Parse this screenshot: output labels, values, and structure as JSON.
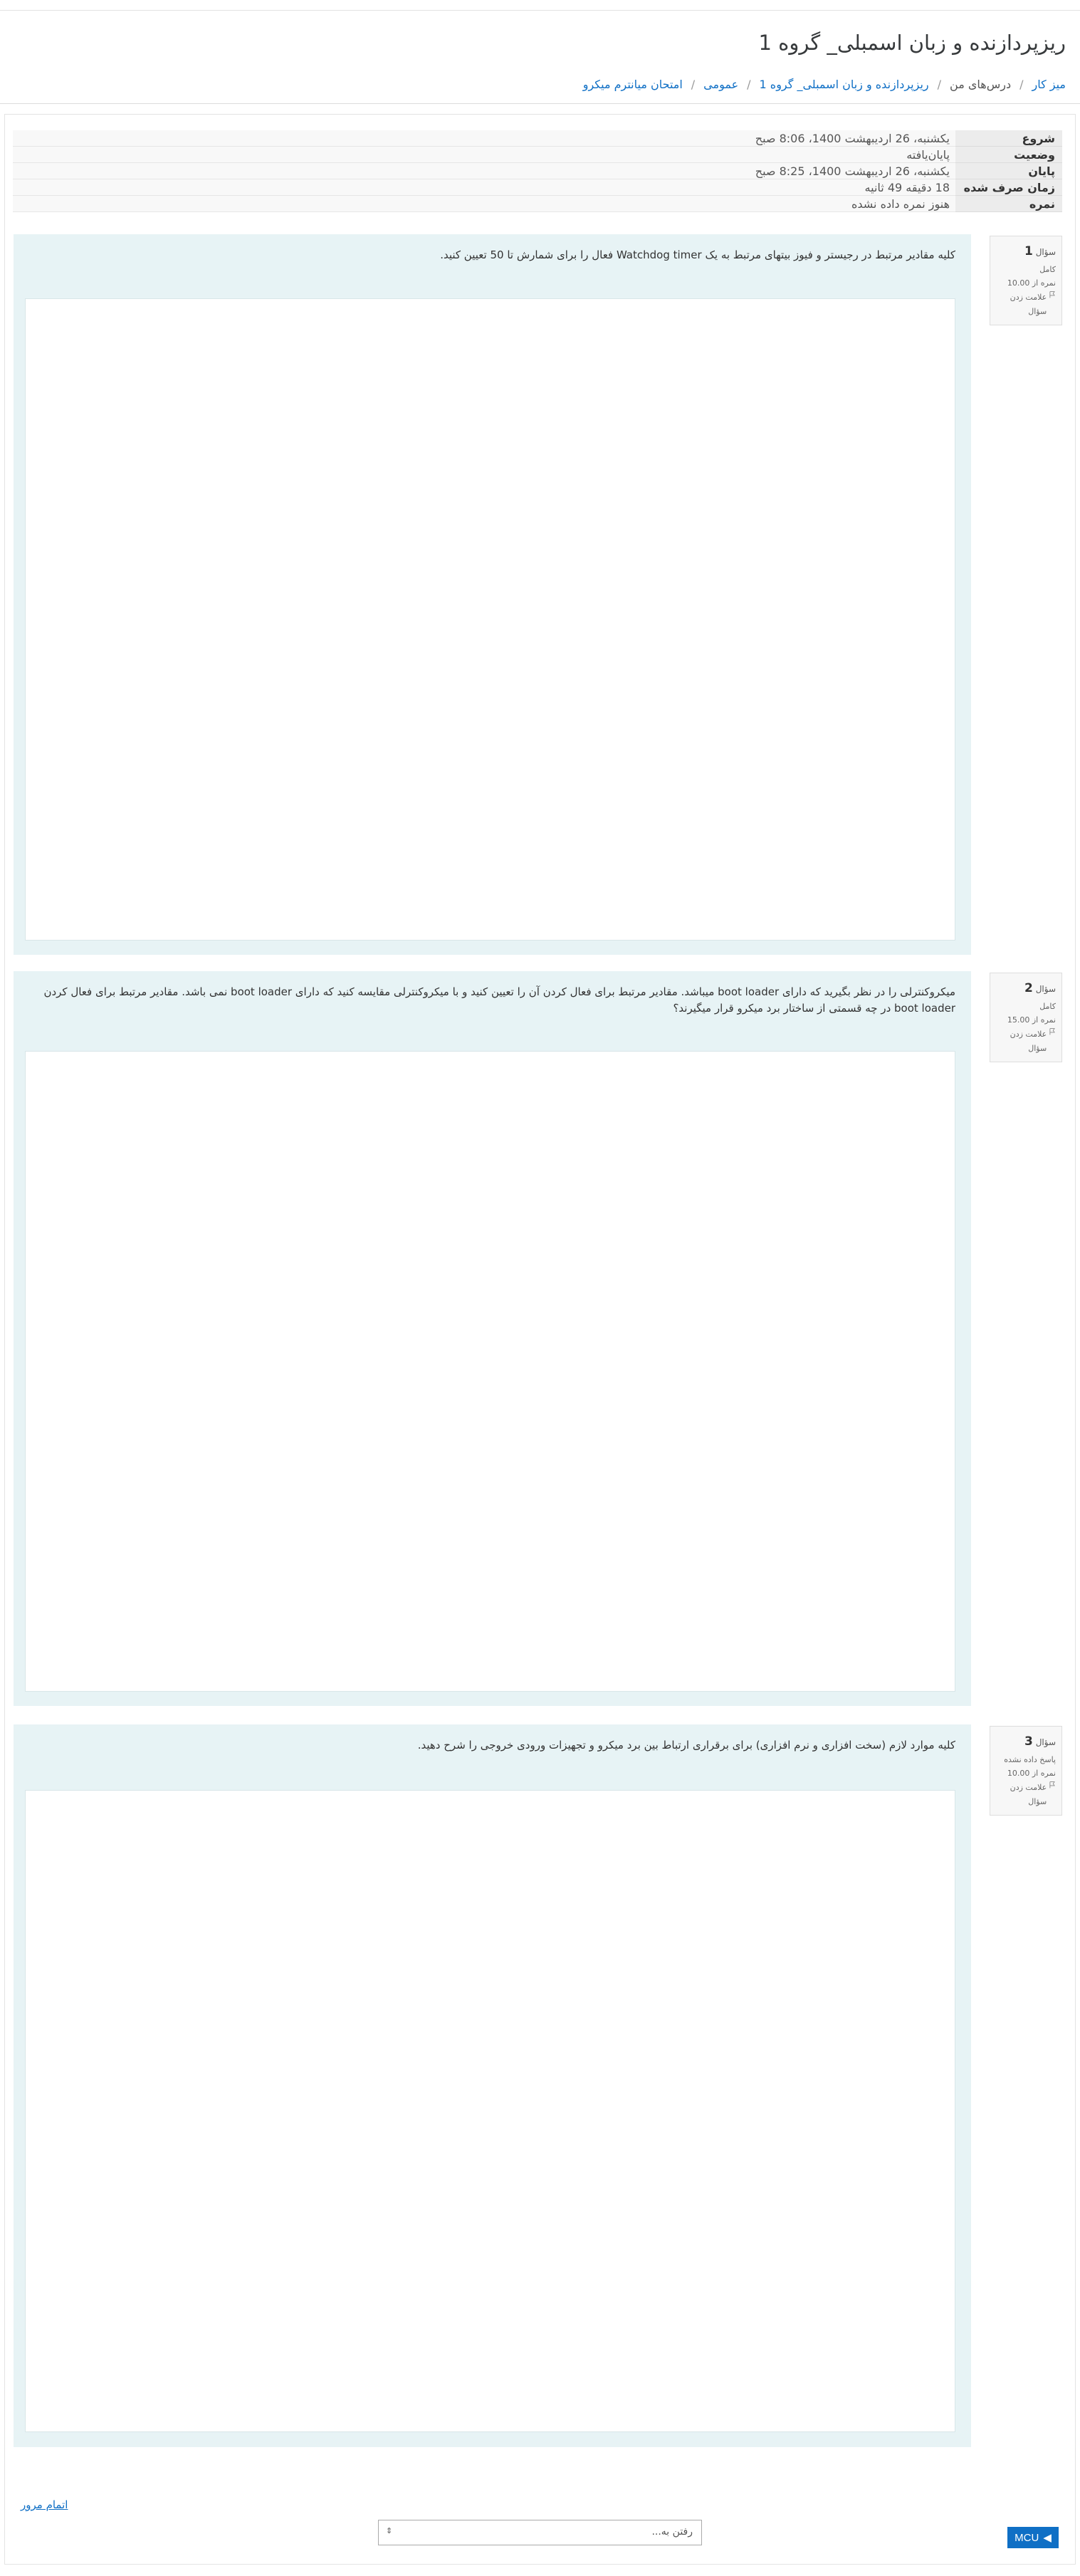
{
  "header": {
    "course_title": "ریزپردازنده و زبان اسمبلی_ گروه 1",
    "breadcrumb": [
      {
        "label": "میز کار",
        "link": true
      },
      {
        "label": "درس‌های من",
        "link": false
      },
      {
        "label": "ریزپردازنده و زبان اسمبلی_ گروه 1",
        "link": true
      },
      {
        "label": "عمومی",
        "link": true
      },
      {
        "label": "امتحان میانترم میکرو",
        "link": true
      }
    ]
  },
  "summary": [
    {
      "label": "شروع",
      "value": "یکشنبه، 26 اردیبهشت 1400، 8:06 صبح"
    },
    {
      "label": "وضعیت",
      "value": "پایان‌یافته"
    },
    {
      "label": "پایان",
      "value": "یکشنبه، 26 اردیبهشت 1400، 8:25 صبح"
    },
    {
      "label": "زمان صرف شده",
      "value": "18 دقیقه 49 ثانیه"
    },
    {
      "label": "نمره",
      "value": "هنوز نمره داده نشده"
    }
  ],
  "questions": [
    {
      "prefix": "سؤال",
      "number": "1",
      "state": "کامل",
      "marks": "نمره از 10.00",
      "flag_label": "علامت زدن سؤال",
      "text": "کلیه مقادیر مرتبط در رجیستر و فیوز بیتهای مرتبط به یک Watchdog timer فعال را برای شمارش تا 50 تعیین کنید."
    },
    {
      "prefix": "سؤال",
      "number": "2",
      "state": "کامل",
      "marks": "نمره از 15.00",
      "flag_label": "علامت زدن سؤال",
      "text": "میکروکنترلی را در نظر بگیرید که دارای boot loader میباشد. مقادیر مرتبط برای فعال کردن آن را تعیین کنید و با میکروکنترلی مقایسه کنید که دارای boot loader نمی باشد. مقادیر مرتبط برای فعال کردن boot loader در چه قسمتی از ساختار برد میکرو قرار میگیرند؟"
    },
    {
      "prefix": "سؤال",
      "number": "3",
      "state": "پاسخ داده نشده",
      "marks": "نمره از 10.00",
      "flag_label": "علامت زدن سؤال",
      "text": "کلیه موارد لازم (سخت افزاری و نرم افزاری) برای برقراری ارتباط بین برد میکرو و تجهیزات ورودی خروجی را شرح دهید."
    }
  ],
  "footer": {
    "finish_review": "اتمام مرور",
    "jump_placeholder": "رفتن به...",
    "prev_activity": "MCU"
  },
  "colors": {
    "link": "#0f6fc5",
    "question_bg": "#e7f3f5",
    "button": "#0f6fc5"
  }
}
